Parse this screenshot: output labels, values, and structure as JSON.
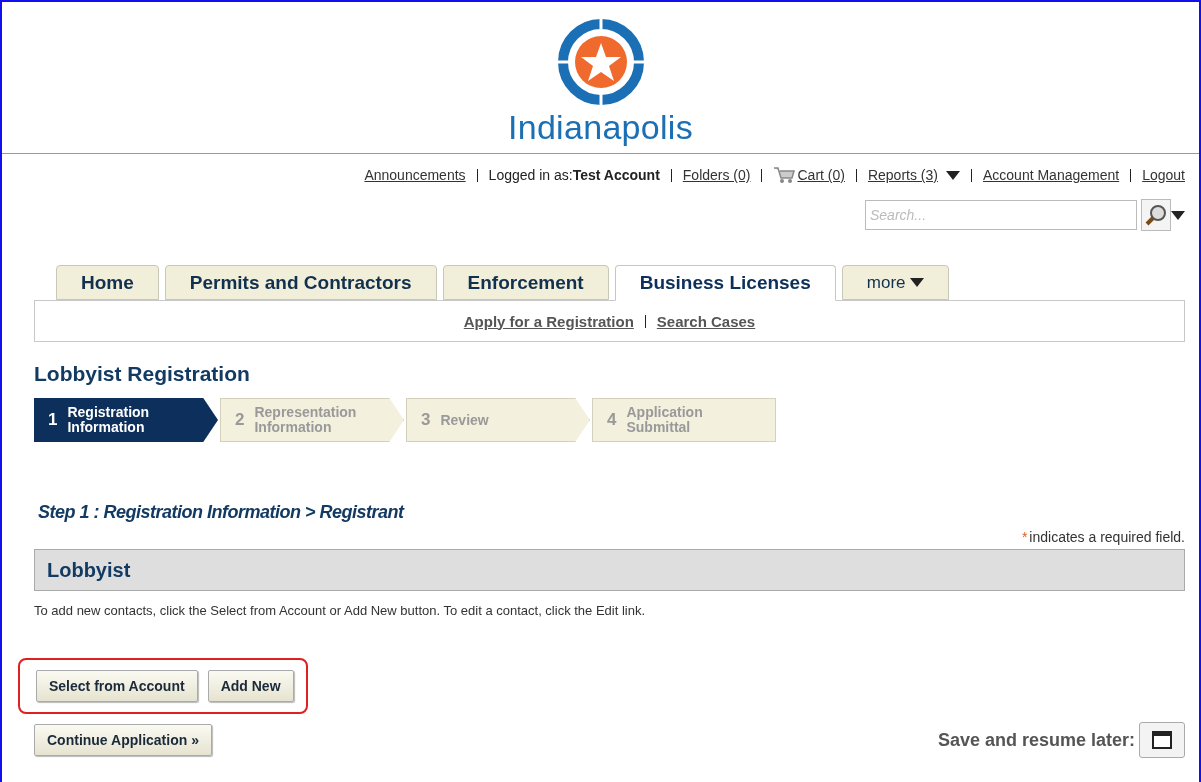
{
  "logo": {
    "name": "Indianapolis"
  },
  "top_links": [
    {
      "kind": "link",
      "text": "Announcements"
    },
    {
      "kind": "login",
      "label": "Logged in as:",
      "user": "Test Account"
    },
    {
      "kind": "link",
      "text": "Folders (0)"
    },
    {
      "kind": "cart",
      "text": "Cart (0)"
    },
    {
      "kind": "menu",
      "text": "Reports (3)"
    },
    {
      "kind": "link",
      "text": "Account Management"
    },
    {
      "kind": "link",
      "text": "Logout"
    }
  ],
  "search": {
    "placeholder": "Search..."
  },
  "tabs": [
    {
      "label": "Home",
      "selected": false,
      "kind": "tab"
    },
    {
      "label": "Permits and Contractors",
      "selected": false,
      "kind": "tab"
    },
    {
      "label": "Enforcement",
      "selected": false,
      "kind": "tab"
    },
    {
      "label": "Business Licenses",
      "selected": true,
      "kind": "tab"
    },
    {
      "label": "more",
      "selected": false,
      "kind": "menu"
    }
  ],
  "sub_nav": [
    "Apply for a Registration",
    "Search Cases"
  ],
  "page_title": "Lobbyist Registration",
  "steps": [
    {
      "number": "1",
      "lines": [
        "Registration",
        "Information"
      ],
      "selected": true
    },
    {
      "number": "2",
      "lines": [
        "Representation",
        "Information"
      ],
      "selected": false
    },
    {
      "number": "3",
      "lines": [
        "Review"
      ],
      "selected": false
    },
    {
      "number": "4",
      "lines": [
        "Application",
        "Submittal"
      ],
      "selected": false
    }
  ],
  "step_heading": "Step 1 : Registration Information > Registrant",
  "required_note": {
    "mark": "*",
    "text": "indicates a required field."
  },
  "section": {
    "title": "Lobbyist",
    "instructions": "To add new contacts, click the Select from Account or Add New button. To edit a contact, click the Edit link."
  },
  "contact_buttons": {
    "highlighted": true,
    "labels": [
      "Select from Account",
      "Add New"
    ]
  },
  "continue_button": "Continue Application »",
  "save": {
    "label": "Save and resume later:"
  }
}
